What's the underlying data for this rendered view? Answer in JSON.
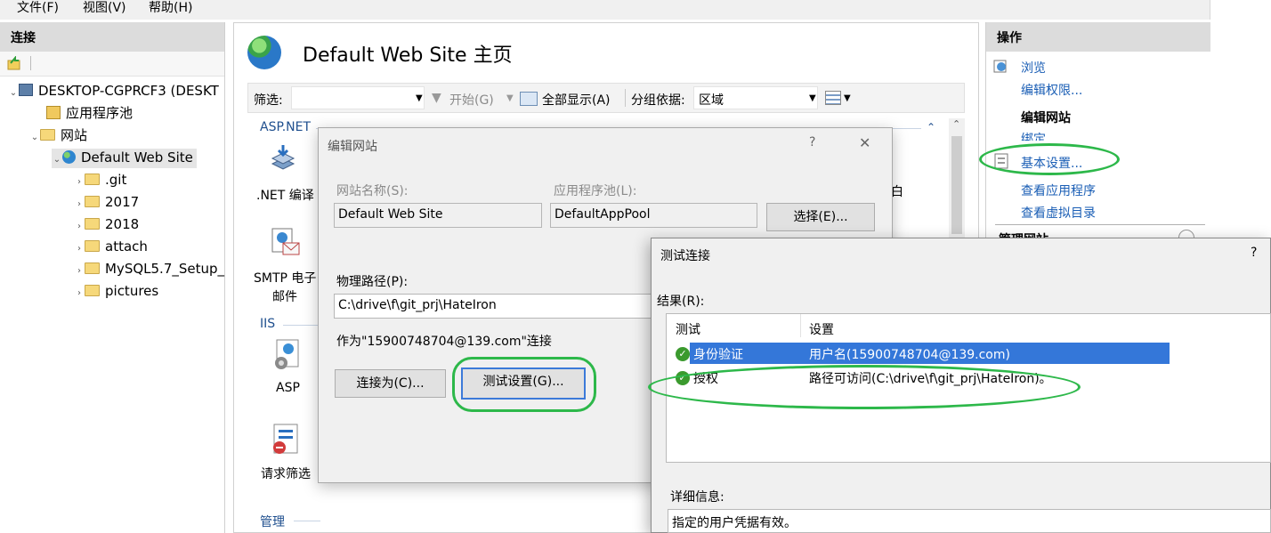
{
  "menu": {
    "file": "文件(F)",
    "view": "视图(V)",
    "help": "帮助(H)"
  },
  "connections": {
    "title": "连接",
    "tree": {
      "server": "DESKTOP-CGPRCF3 (DESKT",
      "app_pools": "应用程序池",
      "sites": "网站",
      "default_site": "Default Web Site",
      "folders": [
        ".git",
        "2017",
        "2018",
        "attach",
        "MySQL5.7_Setup_",
        "pictures"
      ]
    }
  },
  "center": {
    "title": "Default Web Site 主页",
    "filter": {
      "label": "筛选:",
      "start": "开始(G)",
      "show_all": "全部显示(A)",
      "group_by_label": "分组依据:",
      "group_by_value": "区域"
    },
    "sections": {
      "aspnet": "ASP.NET",
      "iis": "IIS",
      "manage": "管理"
    },
    "features": {
      "net_compile": ".NET 编译",
      "smtp_line1": "SMTP 电子",
      "smtp_line2": "邮件",
      "asp": "ASP",
      "request_filter": "请求筛选",
      "edge_char": "白"
    }
  },
  "actions": {
    "title": "操作",
    "browse": "浏览",
    "edit_perms": "编辑权限...",
    "edit_site_head": "编辑网站",
    "bindings": "绑定...",
    "basic_settings": "基本设置...",
    "view_apps": "查看应用程序",
    "view_vdirs": "查看虚拟目录",
    "manage_site_partial": "管理网站"
  },
  "edit_site_dialog": {
    "title": "编辑网站",
    "help": "?",
    "close": "✕",
    "site_name_label": "网站名称(S):",
    "site_name_value": "Default Web Site",
    "app_pool_label": "应用程序池(L):",
    "app_pool_value": "DefaultAppPool",
    "select_button": "选择(E)...",
    "physical_path_label": "物理路径(P):",
    "physical_path_value": "C:\\drive\\f\\git_prj\\HateIron",
    "connect_as_text": "作为\"15900748704@139.com\"连接",
    "connect_as_button": "连接为(C)...",
    "test_settings_button": "测试设置(G)..."
  },
  "test_dialog": {
    "title": "测试连接",
    "help": "?",
    "results_label": "结果(R):",
    "columns": [
      "测试",
      "设置"
    ],
    "rows": [
      {
        "test": "身份验证",
        "setting": "用户名(15900748704@139.com)",
        "selected": true
      },
      {
        "test": "授权",
        "setting": "路径可访问(C:\\drive\\f\\git_prj\\HateIron)。",
        "selected": false
      }
    ],
    "details_label": "详细信息:",
    "details_value": "指定的用户凭据有效。"
  },
  "colors": {
    "annotation": "#2db84a",
    "link": "#1a5eb5",
    "selection": "#3477d9"
  }
}
